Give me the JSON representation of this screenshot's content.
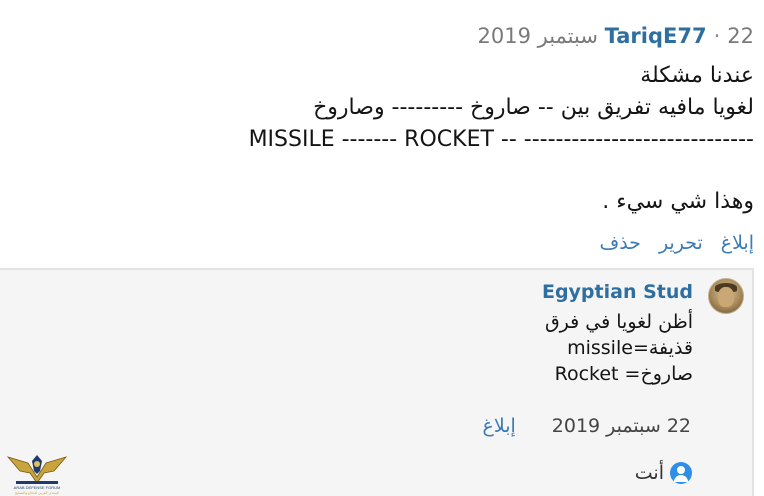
{
  "post": {
    "author": "TariqE77",
    "separator": "·",
    "date": "22 سبتمبر 2019",
    "lines": [
      "عندنا مشكلة",
      "لغويا مافيه تفريق بين -- صاروخ --------- وصاروخ",
      "MISSILE ------- ROCKET -- -----------------------------",
      "",
      "وهذا شي سيء ."
    ],
    "actions": [
      "إبلاغ",
      "تحرير",
      "حذف"
    ]
  },
  "reply": {
    "author": "Egyptian Stud",
    "lines": [
      "أظن لغويا في فرق",
      "قذيفة=missile",
      "صاروخ= Rocket"
    ],
    "date": "22 سبتمبر 2019",
    "report_label": "إبلاغ"
  },
  "composer": {
    "label": "أنت",
    "avatar_icon": "user-avatar-icon"
  },
  "logo": {
    "text_line1": "ARAB DEFENSE FORUM",
    "text_line2": "المنتدى العربي للدفاع والتسليح"
  },
  "colors": {
    "link": "#3a7ab5",
    "author": "#2f6fa0",
    "reply_background": "#f5f5f5"
  }
}
